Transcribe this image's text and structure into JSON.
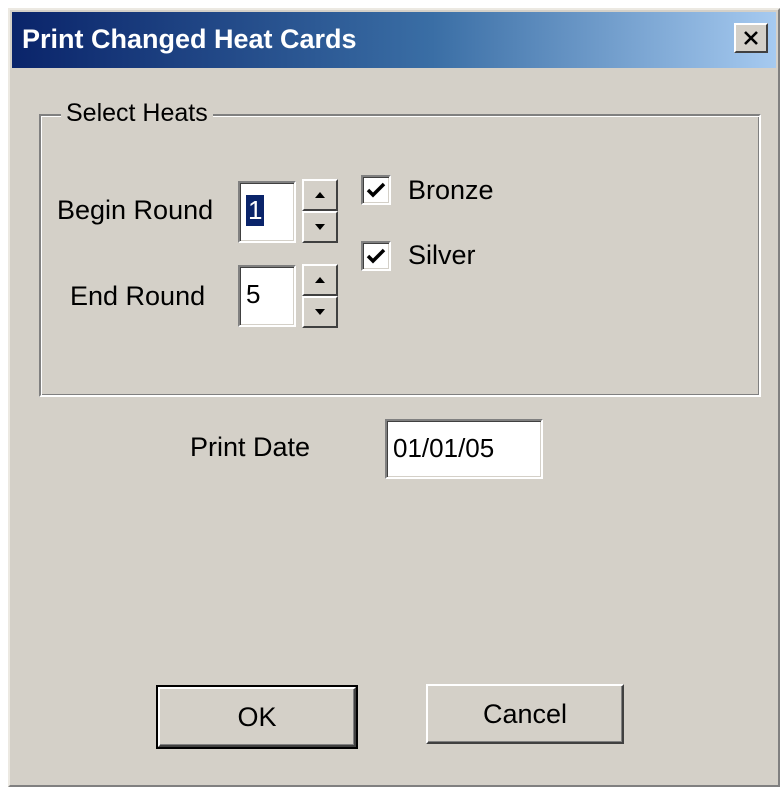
{
  "window": {
    "title": "Print Changed Heat Cards"
  },
  "group": {
    "legend": "Select Heats",
    "begin_round": {
      "label": "Begin Round",
      "value": "1"
    },
    "end_round": {
      "label": "End Round",
      "value": "5"
    },
    "bronze": {
      "label": "Bronze",
      "checked": true
    },
    "silver": {
      "label": "Silver",
      "checked": true
    }
  },
  "print_date": {
    "label": "Print Date",
    "value": "01/01/05"
  },
  "buttons": {
    "ok": "OK",
    "cancel": "Cancel"
  },
  "icons": {
    "close": "close-icon",
    "spin_up": "chevron-up-icon",
    "spin_down": "chevron-down-icon",
    "check": "checkmark-icon"
  },
  "colors": {
    "title_start": "#0a246a",
    "title_end": "#a6caf0",
    "face": "#d4d0c8"
  }
}
